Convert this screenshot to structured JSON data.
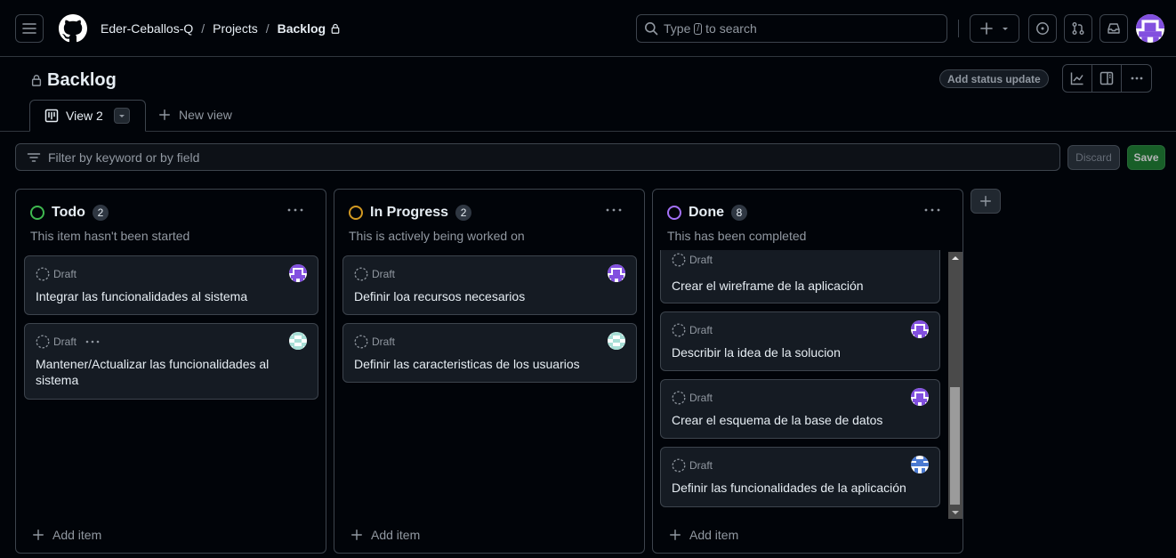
{
  "header": {
    "owner": "Eder-Ceballos-Q",
    "projects": "Projects",
    "current": "Backlog",
    "search_prefix": "Type",
    "search_key": "/",
    "search_suffix": "to search"
  },
  "project": {
    "title": "Backlog",
    "status_update": "Add status update",
    "tab_active": "View 2",
    "new_view": "New view"
  },
  "filter": {
    "placeholder": "Filter by keyword or by field",
    "discard": "Discard",
    "save": "Save"
  },
  "columns": [
    {
      "name": "Todo",
      "count": "2",
      "description": "This item hasn't been started",
      "color": "#3fb950",
      "add_item": "Add item",
      "cards": [
        {
          "status": "Draft",
          "title": "Integrar las funcionalidades al sistema",
          "avatar": "purple-avatar"
        },
        {
          "status": "Draft",
          "title": "Mantener/Actualizar las funcionalidades al sistema",
          "avatar": "teal-avatar"
        }
      ]
    },
    {
      "name": "In Progress",
      "count": "2",
      "description": "This is actively being worked on",
      "color": "#d29922",
      "add_item": "Add item",
      "cards": [
        {
          "status": "Draft",
          "title": "Definir loa recursos necesarios",
          "avatar": "purple-avatar"
        },
        {
          "status": "Draft",
          "title": "Definir las caracteristicas de los usuarios",
          "avatar": "teal-avatar"
        }
      ]
    },
    {
      "name": "Done",
      "count": "8",
      "description": "This has been completed",
      "color": "#a371f7",
      "add_item": "Add item",
      "cards": [
        {
          "status": "Draft",
          "title": "Crear el wireframe de la aplicación",
          "avatar": ""
        },
        {
          "status": "Draft",
          "title": "Describir la idea de la solucion",
          "avatar": "purple-avatar"
        },
        {
          "status": "Draft",
          "title": "Crear el esquema de la base de datos",
          "avatar": "purple-avatar"
        },
        {
          "status": "Draft",
          "title": "Definir las funcionalidades de la aplicación",
          "avatar": "blue-avatar"
        }
      ]
    }
  ]
}
